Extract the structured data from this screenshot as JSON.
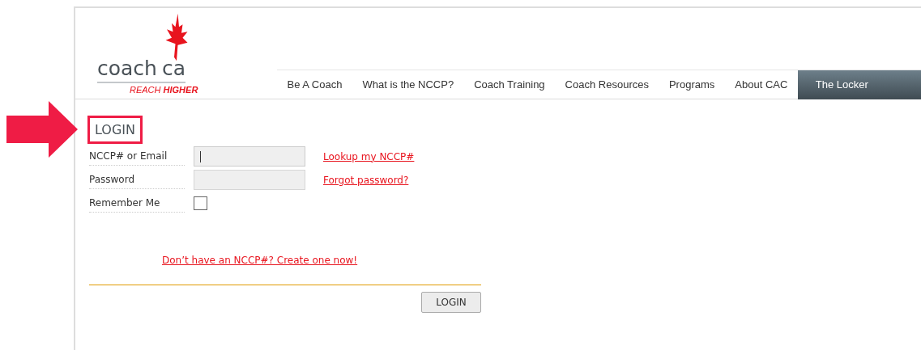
{
  "logo": {
    "name_left": "coach",
    "name_right": "ca",
    "tagline_light": "REACH",
    "tagline_bold": "HIGHER"
  },
  "nav": [
    {
      "label": "Be A Coach",
      "selected": false
    },
    {
      "label": "What is the NCCP?",
      "selected": false
    },
    {
      "label": "Coach Training",
      "selected": false
    },
    {
      "label": "Coach Resources",
      "selected": false
    },
    {
      "label": "Programs",
      "selected": false
    },
    {
      "label": "About CAC",
      "selected": false
    },
    {
      "label": "The Locker",
      "selected": true
    }
  ],
  "heading": {
    "text": "LOGIN",
    "highlighted": true
  },
  "fields": [
    {
      "kind": "text",
      "label": "NCCP# or Email",
      "focused": true,
      "link": "Lookup my NCCP#"
    },
    {
      "kind": "password",
      "label": "Password",
      "focused": false,
      "link": "Forgot password?"
    },
    {
      "kind": "checkbox",
      "label": "Remember Me",
      "checked": false
    }
  ],
  "create_link": "Don’t have an NCCP#? Create one now!",
  "submit": "LOGIN"
}
